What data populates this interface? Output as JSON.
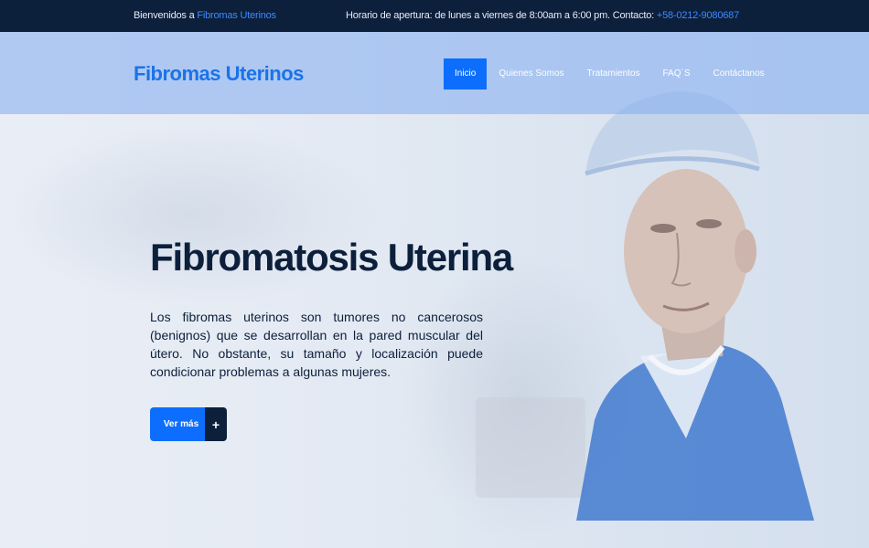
{
  "topbar": {
    "welcome_prefix": "Bienvenidos a",
    "welcome_brand": "Fibromas Uterinos",
    "hours_text": "Horario de apertura: de lunes a viernes de 8:00am a 6:00 pm. Contacto:",
    "phone": "+58-0212-9080687"
  },
  "header": {
    "logo": "Fibromas Uterinos",
    "nav": [
      {
        "label": "Inicio",
        "active": true
      },
      {
        "label": "Quienes Somos",
        "active": false
      },
      {
        "label": "Tratamientos",
        "active": false
      },
      {
        "label": "FAQ´S",
        "active": false
      },
      {
        "label": "Contáctanos",
        "active": false
      }
    ]
  },
  "hero": {
    "title": "Fibromatosis Uterina",
    "text": "Los fibromas uterinos son tumores no cancerosos (benignos) que se desarrollan en la pared muscular del útero. No obstante, su tamaño y localización puede condicionar problemas a algunas mujeres.",
    "button_label": "Ver más",
    "button_icon": "+"
  },
  "colors": {
    "navy": "#0c1f3b",
    "accent": "#0d6efd",
    "brand_link": "#3d8bff"
  }
}
